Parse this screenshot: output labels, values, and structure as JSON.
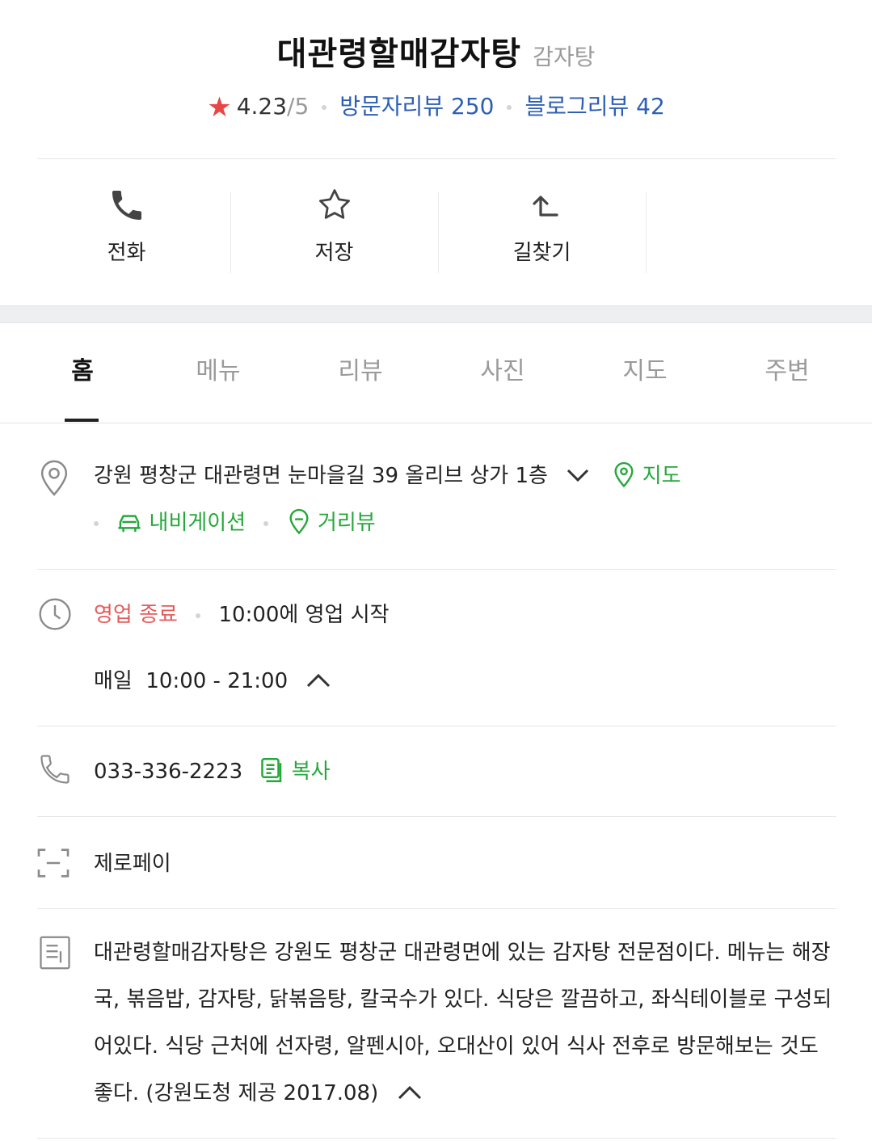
{
  "header": {
    "title": "대관령할매감자탕",
    "category": "감자탕",
    "rating": "4.23",
    "rating_max": "/5",
    "visitor_reviews": "방문자리뷰 250",
    "blog_reviews": "블로그리뷰 42"
  },
  "actions": {
    "call": "전화",
    "save": "저장",
    "directions": "길찾기"
  },
  "tabs": [
    "홈",
    "메뉴",
    "리뷰",
    "사진",
    "지도",
    "주변"
  ],
  "address": {
    "text": "강원 평창군 대관령면 눈마을길 39 올리브 상가 1층",
    "map": "지도",
    "navigation": "내비게이션",
    "street_view": "거리뷰"
  },
  "hours": {
    "status": "영업 종료",
    "next": "10:00에 영업 시작",
    "schedule": "매일  10:00 - 21:00"
  },
  "phone": {
    "number": "033-336-2223",
    "copy": "복사"
  },
  "zeropay": "제로페이",
  "description": "대관령할매감자탕은 강원도 평창군 대관령면에 있는 감자탕 전문점이다. 메뉴는 해장국, 볶음밥, 감자탕, 닭볶음탕, 칼국수가 있다. 식당은 깔끔하고, 좌식테이블로 구성되어있다. 식당 근처에 선자령, 알펜시아, 오대산이 있어 식사 전후로 방문해보는 것도 좋다. (강원도청 제공 2017.08)",
  "colors": {
    "accent_green": "#25a83a",
    "link_blue": "#2d5fb5",
    "star_red": "#e84545",
    "closed_red": "#e65a5a"
  }
}
